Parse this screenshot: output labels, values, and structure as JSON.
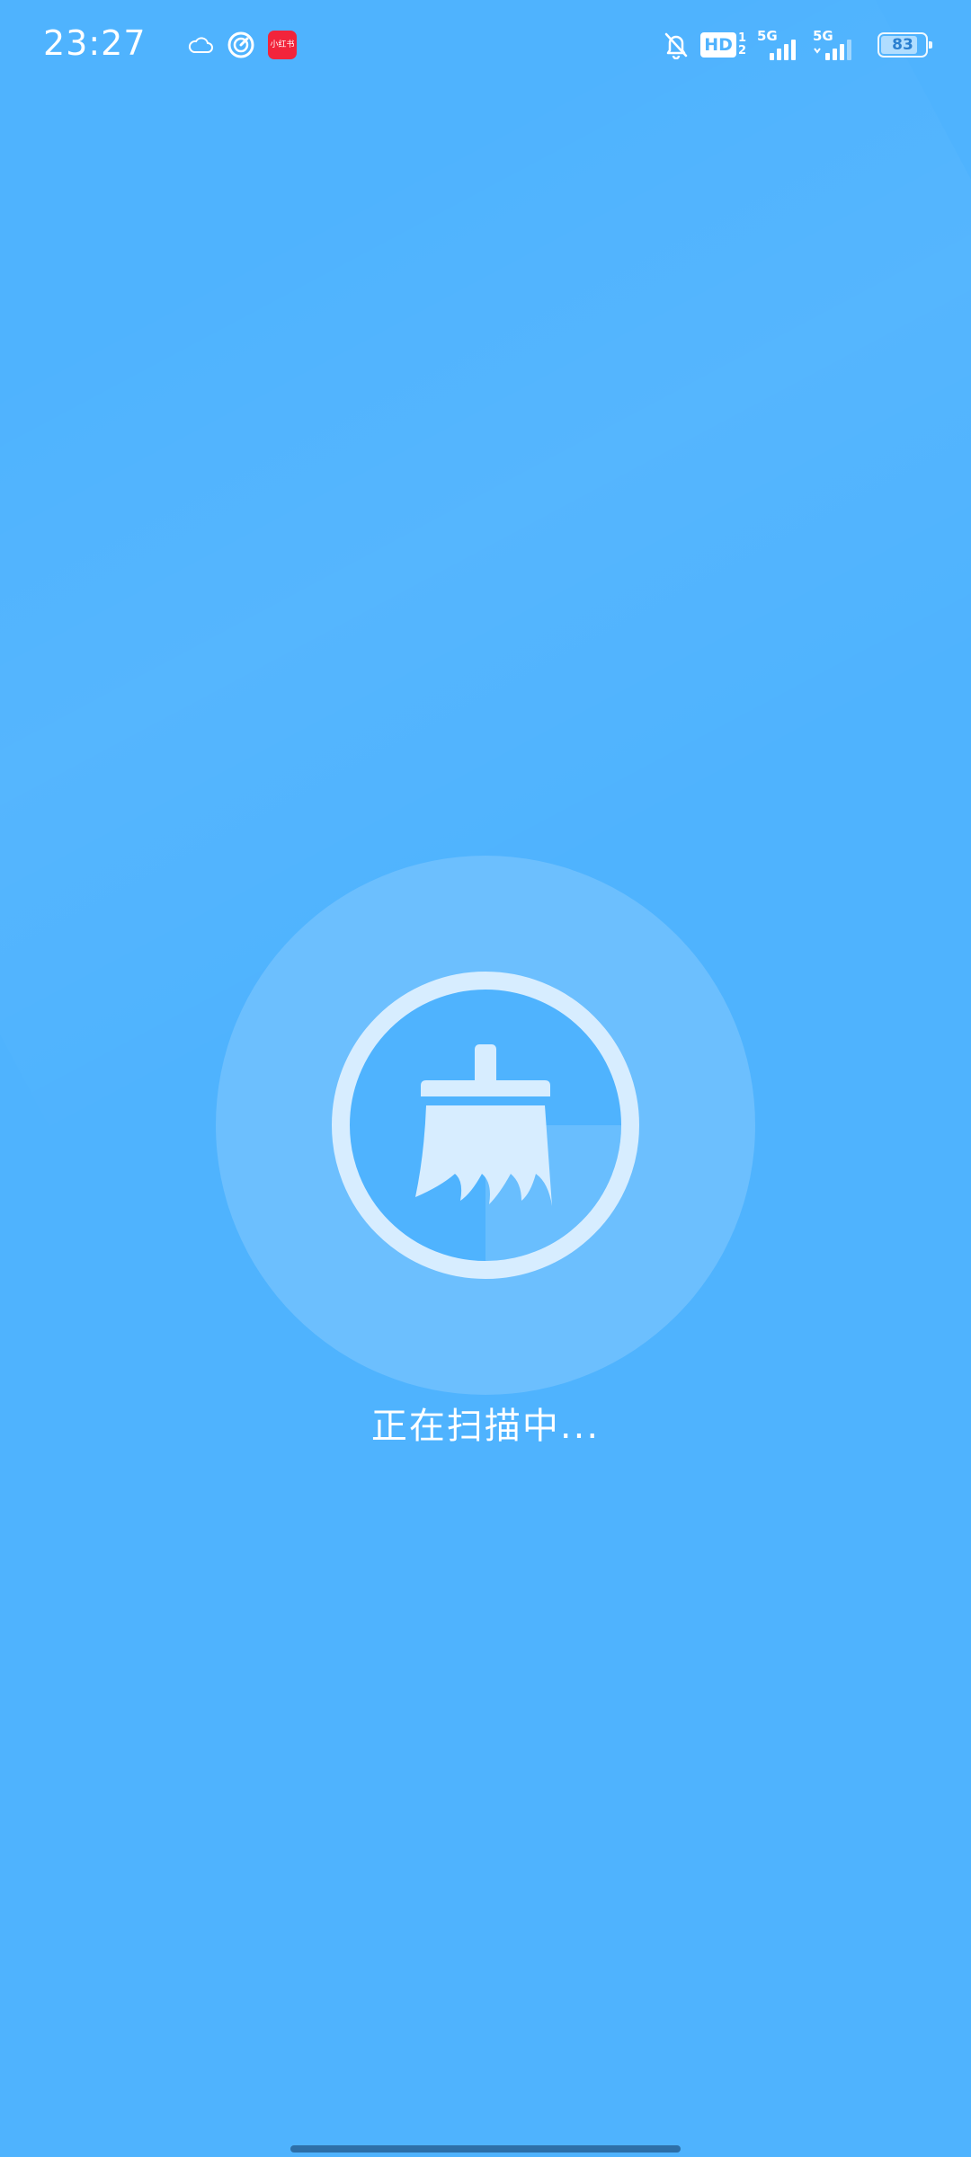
{
  "status_bar": {
    "time": "23:27",
    "left_icons": [
      "cloud-icon",
      "speedometer-icon",
      "app-notification-icon"
    ],
    "app_badge_text": "小红书",
    "right_icons": [
      "bell-off-icon",
      "hd-icon",
      "signal-5g-icon",
      "signal-5g-icon",
      "battery-icon"
    ],
    "hd_label": "HD",
    "hd_sub_top": "1",
    "hd_sub_bottom": "2",
    "signal1_label": "5G",
    "signal2_label": "5G",
    "battery_level": "83"
  },
  "scan": {
    "icon": "broom-icon",
    "status_text": "正在扫描中..."
  },
  "colors": {
    "background": "#4fb3fe",
    "outer_circle": "#6cbffe",
    "ring": "#d7edff",
    "text": "#ffffff"
  }
}
